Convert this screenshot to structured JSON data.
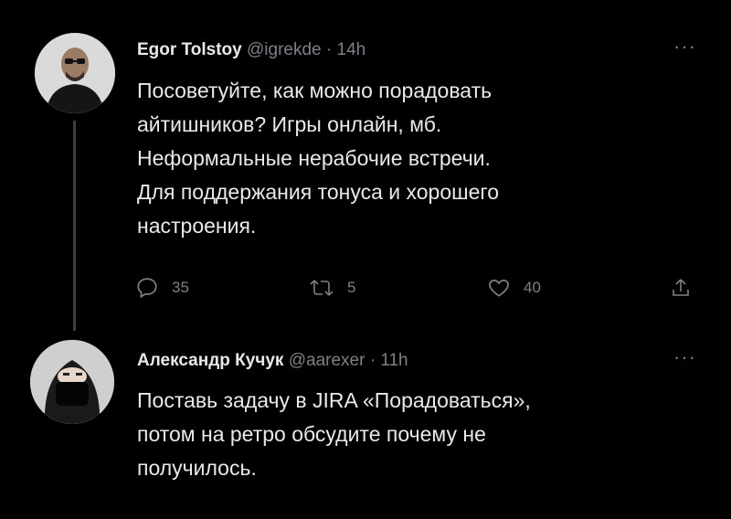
{
  "tweets": [
    {
      "author": "Egor Tolstoy",
      "handle": "@igrekde",
      "separator": "·",
      "time": "14h",
      "more": "···",
      "lines": [
        "Посоветуйте, как можно порадовать",
        "айтишников? Игры онлайн, мб.",
        "Неформальные нерабочие встречи.",
        "Для поддержания тонуса и хорошего",
        "настроения."
      ],
      "replies": "35",
      "retweets": "5",
      "likes": "40"
    },
    {
      "author": "Александр Кучук",
      "handle": "@aarexer",
      "separator": "·",
      "time": "11h",
      "more": "···",
      "lines": [
        "Поставь задачу в JIRA «Порадоваться»,",
        "потом на ретро обсудите почему не",
        "получилось."
      ]
    }
  ],
  "icons": {
    "reply": "reply-icon",
    "retweet": "retweet-icon",
    "like": "heart-icon",
    "share": "share-icon"
  },
  "colors": {
    "background": "#000000",
    "text": "#e7e9ea",
    "muted": "#7b8187",
    "thread_line": "#3a3f45"
  }
}
